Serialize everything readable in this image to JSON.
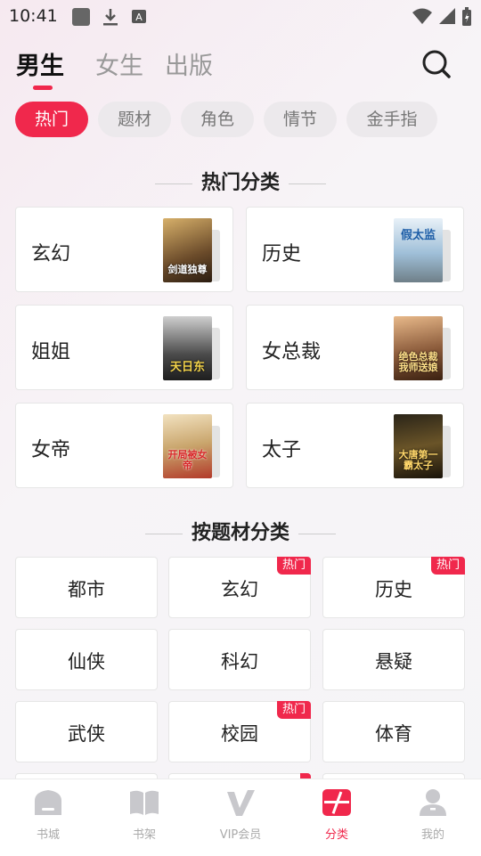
{
  "status_bar": {
    "time": "10:41"
  },
  "top_tabs": [
    {
      "label": "男生",
      "active": true
    },
    {
      "label": "女生",
      "active": false
    },
    {
      "label": "出版",
      "active": false
    }
  ],
  "chips": [
    {
      "label": "热门",
      "active": true
    },
    {
      "label": "题材",
      "active": false
    },
    {
      "label": "角色",
      "active": false
    },
    {
      "label": "情节",
      "active": false
    },
    {
      "label": "金手指",
      "active": false
    }
  ],
  "hot_section": {
    "title": "热门分类",
    "items": [
      {
        "label": "玄幻",
        "cover_text": "剑道独尊",
        "cover_color": "#6b4b2a"
      },
      {
        "label": "历史",
        "cover_text": "假太监",
        "cover_color": "#7fa6c8"
      },
      {
        "label": "姐姐",
        "cover_text": "天日东",
        "cover_color": "#3b3b3b"
      },
      {
        "label": "女总裁",
        "cover_text": "绝色总裁 我师送娘",
        "cover_color": "#8a5a3a"
      },
      {
        "label": "女帝",
        "cover_text": "开局被女帝",
        "cover_color": "#c9a56c"
      },
      {
        "label": "太子",
        "cover_text": "大唐第一 霸太子",
        "cover_color": "#5a4a2a"
      }
    ]
  },
  "theme_section": {
    "title": "按题材分类",
    "items": [
      {
        "label": "都市",
        "badge": ""
      },
      {
        "label": "玄幻",
        "badge": "热门"
      },
      {
        "label": "历史",
        "badge": "热门"
      },
      {
        "label": "仙侠",
        "badge": ""
      },
      {
        "label": "科幻",
        "badge": ""
      },
      {
        "label": "悬疑",
        "badge": ""
      },
      {
        "label": "武侠",
        "badge": ""
      },
      {
        "label": "校园",
        "badge": "热门"
      },
      {
        "label": "体育",
        "badge": ""
      }
    ]
  },
  "bottom_nav": [
    {
      "label": "书城",
      "icon": "home-icon",
      "active": false
    },
    {
      "label": "书架",
      "icon": "book-icon",
      "active": false
    },
    {
      "label": "VIP会员",
      "icon": "vip-icon",
      "active": false
    },
    {
      "label": "分类",
      "icon": "category-icon",
      "active": true
    },
    {
      "label": "我的",
      "icon": "profile-icon",
      "active": false
    }
  ],
  "colors": {
    "accent": "#f0284c",
    "chip_bg": "#ece9ec",
    "inactive_text": "#999999"
  }
}
